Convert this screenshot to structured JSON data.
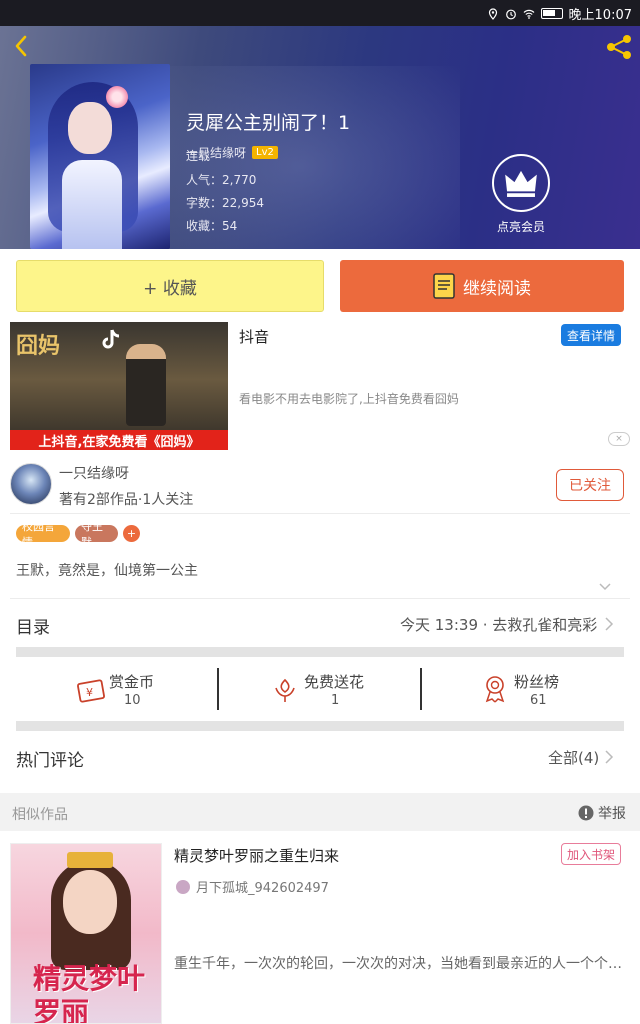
{
  "status_bar": {
    "time": "晚上10:07"
  },
  "book": {
    "title": "灵犀公主别闹了！1",
    "author": "一只结缘呀",
    "level": "Lv2",
    "status": "连载",
    "popularity": "人气：2,770",
    "word_count": "字数：22,954",
    "favorites": "收藏：54",
    "vip_label": "点亮会员"
  },
  "actions": {
    "favorite": "+ 收藏",
    "continue_reading": "继续阅读"
  },
  "ad": {
    "title_art": "囧妈",
    "banner": "上抖音,在家免费看《囧妈》",
    "name": "抖音",
    "detail_button": "查看详情",
    "description": "看电影不用去电影院了,上抖音免费看囧妈",
    "close_label": "×"
  },
  "author_info": {
    "name": "一只结缘呀",
    "stats": "著有2部作品·1人关注",
    "follow_button": "已关注"
  },
  "tags": [
    {
      "label": "校园言情",
      "color": "#f4a63a"
    },
    {
      "label": "夺王默",
      "color": "#c9775e"
    },
    {
      "label": "+",
      "color": "#ec6a3d"
    }
  ],
  "synopsis": "王默，竟然是，仙境第一公主",
  "catalog": {
    "label": "目录",
    "latest": "今天 13:39 · 去救孔雀和亮彩"
  },
  "stats": [
    {
      "label": "赏金币",
      "value": "10",
      "icon": "coin-icon"
    },
    {
      "label": "免费送花",
      "value": "1",
      "icon": "flower-icon"
    },
    {
      "label": "粉丝榜",
      "value": "61",
      "icon": "medal-icon"
    }
  ],
  "comments": {
    "label": "热门评论",
    "all": "全部(4)"
  },
  "similar": {
    "label": "相似作品",
    "report": "举报",
    "items": [
      {
        "title": "精灵梦叶罗丽之重生归来",
        "add_button": "加入书架",
        "author": "月下孤城_942602497",
        "description": "重生千年，一次次的轮回，一次次的对决，当她看到最亲近的人一个个离去",
        "cover_art": "精灵梦叶罗丽"
      }
    ]
  },
  "colors": {
    "accent": "#ec6a3d",
    "favorite_bg": "#fdf58a",
    "link_blue": "#1a7ce0"
  }
}
